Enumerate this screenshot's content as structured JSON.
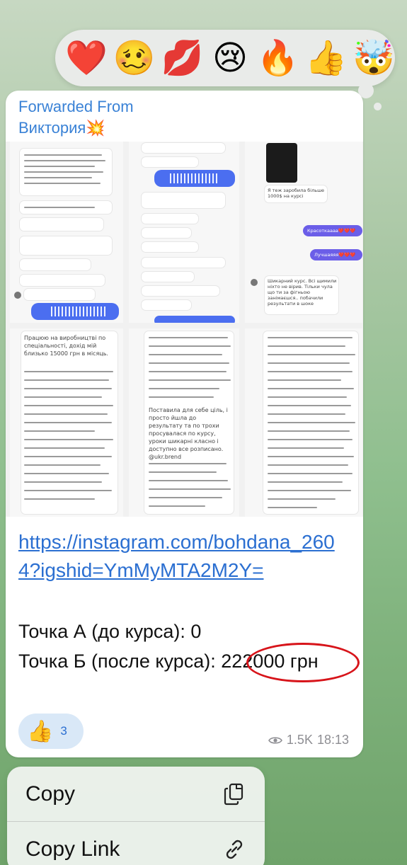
{
  "reactions": [
    {
      "name": "heart",
      "glyph": "❤️"
    },
    {
      "name": "woozy-face",
      "glyph": "🥴"
    },
    {
      "name": "kiss-mark",
      "glyph": "💋"
    },
    {
      "name": "crying-face",
      "glyph": "😢"
    },
    {
      "name": "fire",
      "glyph": "🔥"
    },
    {
      "name": "thumbs-up",
      "glyph": "👍"
    },
    {
      "name": "exploding-head",
      "glyph": "🤯"
    }
  ],
  "message": {
    "forwarded_label": "Forwarded From",
    "forwarded_name": "Виктория💥",
    "link": "https://instagram.com/bohdana_2604?igshid=YmMyMTA2M2Y=",
    "point_a": "Точка А (до курса): 0",
    "point_b": "Точка Б (после курса): 222000 грн",
    "reaction_emoji": "👍",
    "reaction_count": "3",
    "views": "1.5K",
    "time": "18:13"
  },
  "collage": {
    "top_right_bubbles": [
      "Я теж заробила більше 1000$ на курсі",
      "Красоткаааа❤️❤️❤️",
      "Лучшаяяя❤️❤️❤️"
    ],
    "review_right": "Шикарний курс. Всі щимили ніхто не вірив. Тільки чула що ти за фігньою занімаєшся.. побачили результати в шоке",
    "review_middle": "Поставила для себе ціль, і просто йшла до результату та по трохи просувалася по курсу, уроки шикарні класно і доступно все розписано. @ukr.brend",
    "review_left": "Працюю на виробництві по спеціальності, дохід мій близько 15000 грн в місяць."
  },
  "menu": {
    "copy": "Copy",
    "copy_link": "Copy Link"
  },
  "colors": {
    "accent": "#3a82d6",
    "link": "#2b6fd1",
    "highlight": "#d7141a"
  }
}
